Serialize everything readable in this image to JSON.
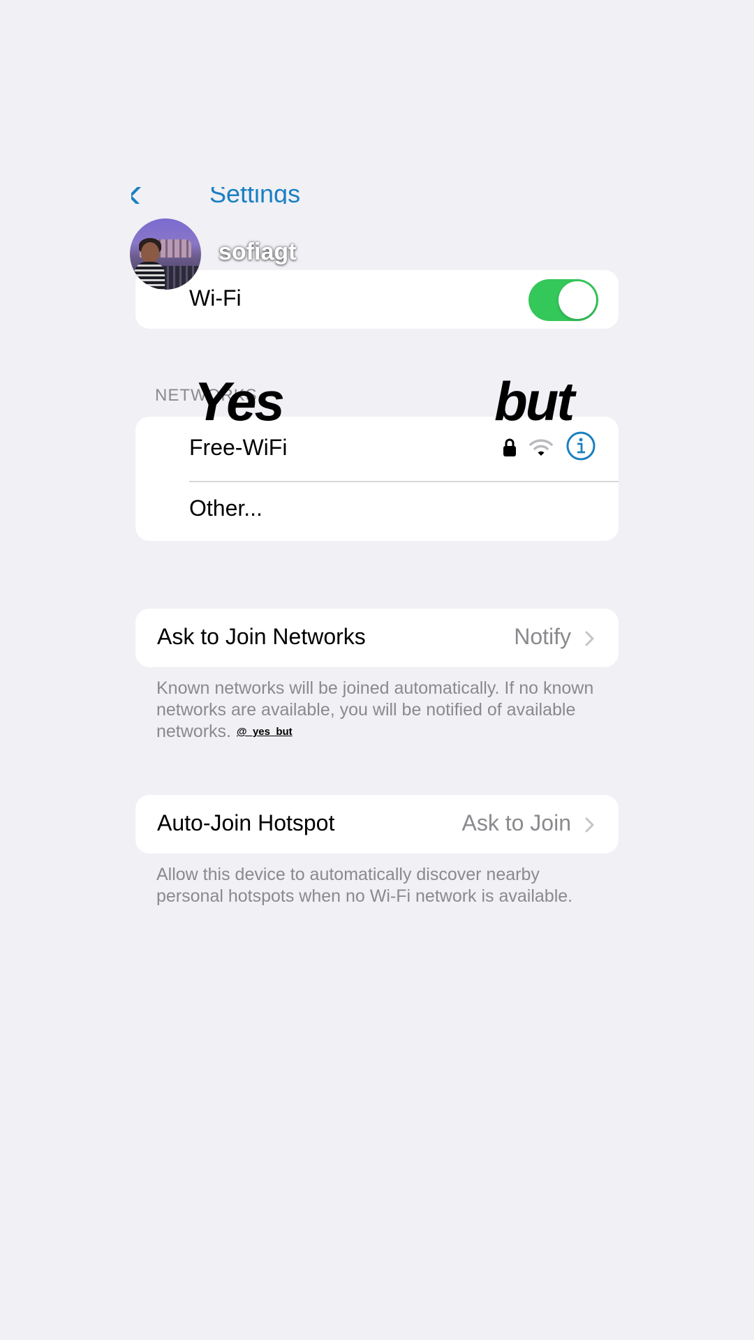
{
  "nav": {
    "back_label": "Settings"
  },
  "overlay": {
    "username": "sofiagt",
    "yes_text": "Yes",
    "but_text": "but",
    "watermark": "@_yes_but"
  },
  "wifi": {
    "label": "Wi-Fi",
    "enabled": true,
    "toggle_color": "#34c759"
  },
  "networks": {
    "section_header": "NETWORKS",
    "items": [
      {
        "name": "Free-WiFi",
        "icons": [
          "lock-icon",
          "wifi-signal-icon",
          "info-icon"
        ]
      },
      {
        "name": "Other..."
      }
    ]
  },
  "ask_to_join": {
    "label": "Ask to Join Networks",
    "value": "Notify",
    "footnote": "Known networks will be joined automatically. If no known networks are available, you will be notified of available networks."
  },
  "auto_join": {
    "label": "Auto-Join Hotspot",
    "value": "Ask to Join",
    "footnote": "Allow this device to automatically discover nearby personal hotspots when no Wi-Fi network is available."
  },
  "colors": {
    "background": "#f0f0f5",
    "accent": "#1a7fc1",
    "secondary_text": "#8a8a8e"
  }
}
